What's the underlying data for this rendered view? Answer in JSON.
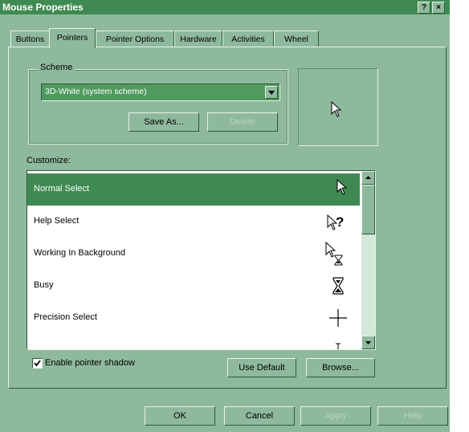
{
  "window": {
    "title": "Mouse Properties",
    "help_label": "?",
    "close_label": "×"
  },
  "tabs": [
    {
      "label": "Buttons",
      "active": false
    },
    {
      "label": "Pointers",
      "active": true
    },
    {
      "label": "Pointer Options",
      "active": false
    },
    {
      "label": "Hardware",
      "active": false
    },
    {
      "label": "Activities",
      "active": false
    },
    {
      "label": "Wheel",
      "active": false
    }
  ],
  "scheme": {
    "label": "Scheme",
    "selected": "3D-White (system scheme)",
    "save_as_label": "Save As...",
    "delete_label": "Delete"
  },
  "customize": {
    "label": "Customize:",
    "items": [
      {
        "label": "Normal Select",
        "cursor_icon": "arrow-icon",
        "selected": true
      },
      {
        "label": "Help Select",
        "cursor_icon": "help-select-icon",
        "selected": false
      },
      {
        "label": "Working In Background",
        "cursor_icon": "working-background-icon",
        "selected": false
      },
      {
        "label": "Busy",
        "cursor_icon": "hourglass-icon",
        "selected": false
      },
      {
        "label": "Precision Select",
        "cursor_icon": "crosshair-icon",
        "selected": false
      }
    ]
  },
  "shadow": {
    "label": "Enable pointer shadow",
    "checked": true
  },
  "buttons": {
    "use_default": "Use Default",
    "browse": "Browse...",
    "ok": "OK",
    "cancel": "Cancel",
    "apply": "Apply",
    "help": "Help"
  },
  "colors": {
    "dialog_bg": "#8fb99d",
    "selection": "#3f8a52",
    "list_bg": "#ffffff"
  }
}
